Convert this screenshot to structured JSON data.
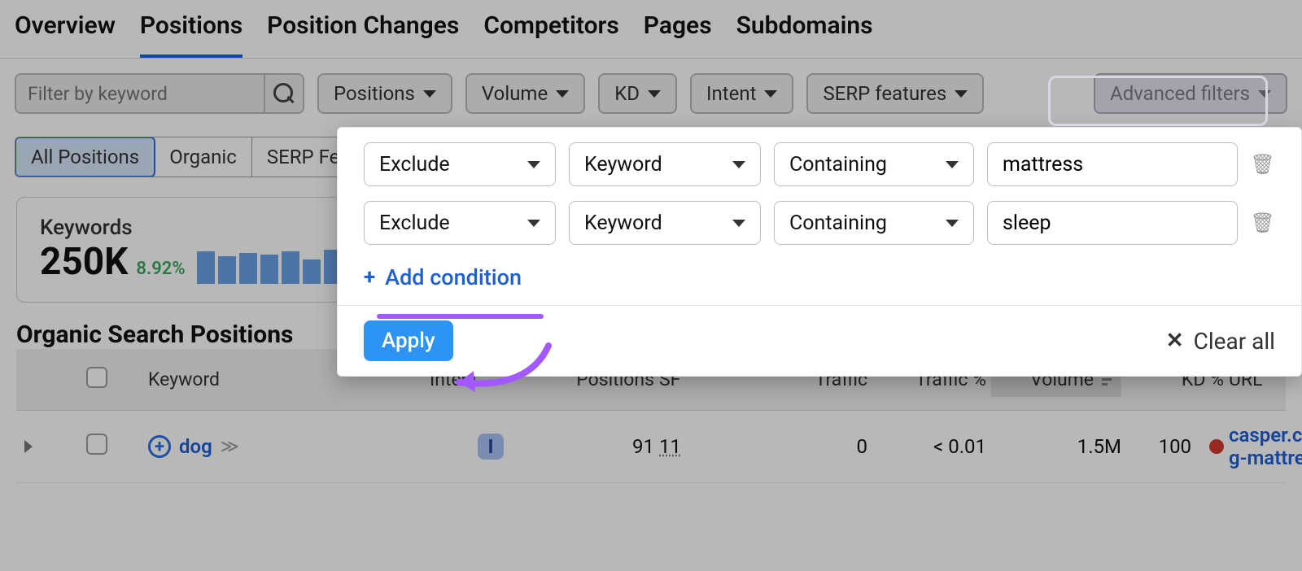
{
  "tabs": [
    "Overview",
    "Positions",
    "Position Changes",
    "Competitors",
    "Pages",
    "Subdomains"
  ],
  "active_tab": 1,
  "keyword_filter_placeholder": "Filter by keyword",
  "filter_dropdowns": [
    "Positions",
    "Volume",
    "KD",
    "Intent",
    "SERP features",
    "Advanced filters"
  ],
  "position_segments": [
    "All Positions",
    "Organic",
    "SERP Fe"
  ],
  "stats": {
    "label": "Keywords",
    "value": "250K",
    "pct": "8.92%"
  },
  "section_title": "Organic Search Positions",
  "columns": [
    "Keyword",
    "Intent",
    "Positions",
    "SF",
    "Traffic",
    "Traffic %",
    "Volume",
    "KD %",
    "URL"
  ],
  "row": {
    "keyword": "dog",
    "intent": "I",
    "positions": "91",
    "sf": "11",
    "traffic": "0",
    "traffic_pct": "< 0.01",
    "volume": "1.5M",
    "kd": "100",
    "url": "casper.com/",
    "url2": "g-mattresse"
  },
  "popup": {
    "conditions": [
      {
        "action": "Exclude",
        "field": "Keyword",
        "op": "Containing",
        "value": "mattress"
      },
      {
        "action": "Exclude",
        "field": "Keyword",
        "op": "Containing",
        "value": "sleep"
      }
    ],
    "add_condition": "Add condition",
    "apply": "Apply",
    "clear": "Clear all"
  }
}
